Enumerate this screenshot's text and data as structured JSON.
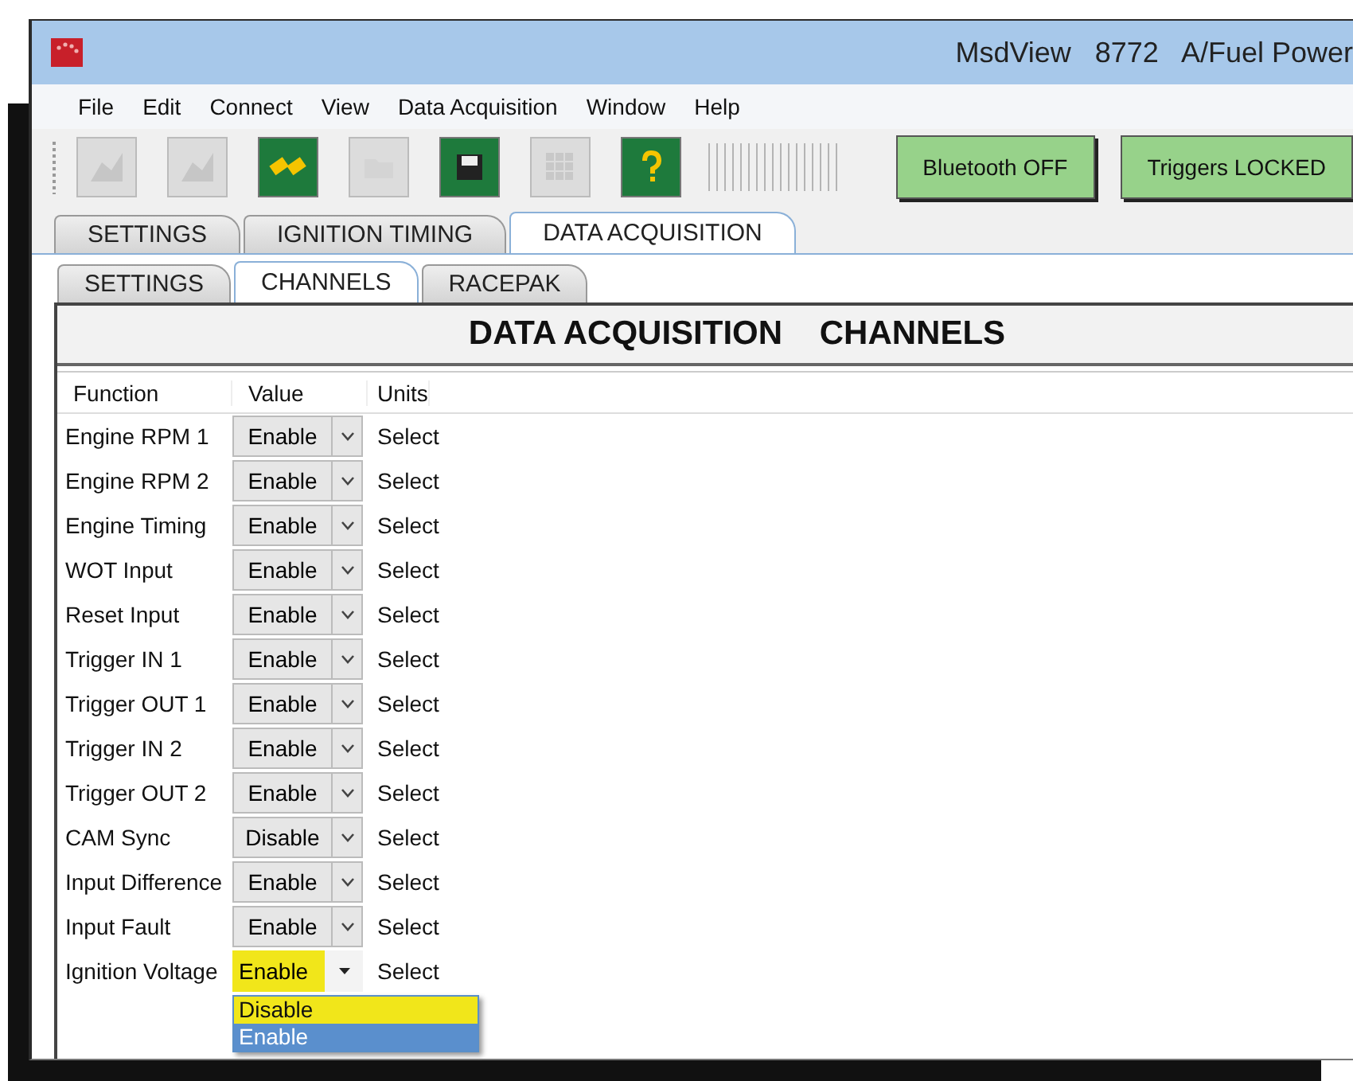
{
  "window": {
    "title": "MsdView   8772   A/Fuel Power"
  },
  "menu": [
    "File",
    "Edit",
    "Connect",
    "View",
    "Data Acquisition",
    "Window",
    "Help"
  ],
  "toolbar": [
    {
      "disabled": true
    },
    {
      "disabled": true
    },
    {
      "disabled": false
    },
    {
      "disabled": true
    },
    {
      "disabled": false
    },
    {
      "disabled": true
    },
    {
      "disabled": false
    }
  ],
  "status_buttons": [
    "Bluetooth OFF",
    "Triggers LOCKED"
  ],
  "tabs": [
    {
      "label": "SETTINGS",
      "selected": false
    },
    {
      "label": "IGNITION TIMING",
      "selected": false
    },
    {
      "label": "DATA ACQUISITION",
      "selected": true
    }
  ],
  "subtabs": [
    {
      "label": "SETTINGS",
      "selected": false
    },
    {
      "label": "CHANNELS",
      "selected": true
    },
    {
      "label": "RACEPAK",
      "selected": false
    }
  ],
  "panel": {
    "title": "DATA ACQUISITION    CHANNELS"
  },
  "table": {
    "columns": [
      "Function",
      "Value",
      "Units"
    ],
    "rows": [
      {
        "function": "Engine RPM 1",
        "value": "Enable",
        "units": "Select",
        "open": false
      },
      {
        "function": "Engine RPM 2",
        "value": "Enable",
        "units": "Select",
        "open": false
      },
      {
        "function": "Engine Timing",
        "value": "Enable",
        "units": "Select",
        "open": false
      },
      {
        "function": "WOT Input",
        "value": "Enable",
        "units": "Select",
        "open": false
      },
      {
        "function": "Reset Input",
        "value": "Enable",
        "units": "Select",
        "open": false
      },
      {
        "function": "Trigger IN 1",
        "value": "Enable",
        "units": "Select",
        "open": false
      },
      {
        "function": "Trigger OUT 1",
        "value": "Enable",
        "units": "Select",
        "open": false
      },
      {
        "function": "Trigger IN 2",
        "value": "Enable",
        "units": "Select",
        "open": false
      },
      {
        "function": "Trigger OUT 2",
        "value": "Enable",
        "units": "Select",
        "open": false
      },
      {
        "function": "CAM Sync",
        "value": "Disable",
        "units": "Select",
        "open": false
      },
      {
        "function": "Input Difference",
        "value": "Enable",
        "units": "Select",
        "open": false
      },
      {
        "function": "Input Fault",
        "value": "Enable",
        "units": "Select",
        "open": false
      },
      {
        "function": "Ignition Voltage",
        "value": "Enable",
        "units": "Select",
        "open": true,
        "options": [
          {
            "label": "Disable",
            "selected": false,
            "highlighted": true
          },
          {
            "label": "Enable",
            "selected": true,
            "highlighted": false
          }
        ]
      }
    ]
  }
}
